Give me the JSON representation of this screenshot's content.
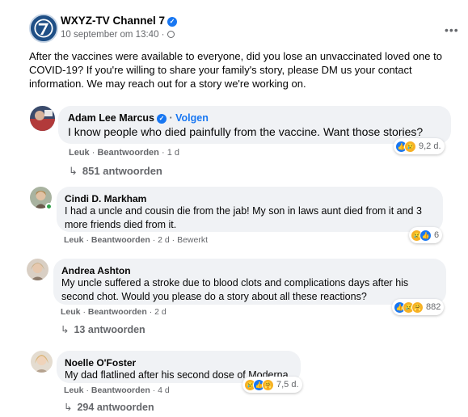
{
  "post": {
    "page_name": "WXYZ-TV Channel 7",
    "timestamp": "10 september om 13:40",
    "text": "After the vaccines were available to everyone, did you lose an unvaccinated loved one to COVID-19? If you're willing to share your family's story, please DM us your contact information. We may reach out for a story we're working on."
  },
  "ui": {
    "like": "Leuk",
    "reply": "Beantwoorden",
    "dot": "·",
    "edited": "Bewerkt",
    "follow": "Volgen"
  },
  "comments": [
    {
      "author": "Adam Lee Marcus",
      "verified": true,
      "text": "I know people who died painfully from the vaccine. Want those stories?",
      "time": "1 d",
      "reaction_count": "9,2 d.",
      "replies": "851 antwoorden"
    },
    {
      "author": "Cindi D. Markham",
      "text": "I had a uncle and cousin die from the jab! My son in laws aunt died from it and 3 more friends died from it.",
      "time": "2 d",
      "reaction_count": "6"
    },
    {
      "author": "Andrea Ashton",
      "text": "My uncle suffered a stroke due to blood clots and complications days after his second chot. Would you please do a story about all these reactions?",
      "time": "2 d",
      "reaction_count": "882",
      "replies": "13 antwoorden"
    },
    {
      "author": "Noelle O'Foster",
      "text": "My dad flatlined after his second dose of Moderna",
      "time": "4 d",
      "reaction_count": "7,5 d.",
      "replies": "294 antwoorden"
    }
  ],
  "icons": {
    "more": "more-options-icon",
    "globe": "globe-icon",
    "verified": "verified-badge-icon",
    "reply_arrow": "reply-arrow-icon",
    "reactions": [
      "like-icon",
      "sad-icon",
      "care-icon"
    ]
  },
  "colors": {
    "accent": "#1877f2",
    "bubble": "#f0f2f5",
    "muted": "#65676b",
    "online": "#31a24c"
  }
}
